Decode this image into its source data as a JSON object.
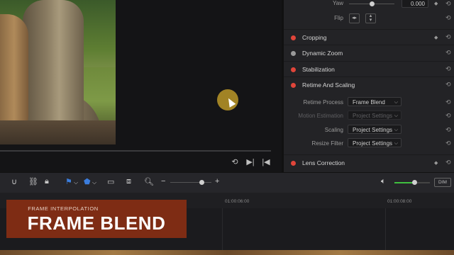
{
  "inspector": {
    "transform": {
      "yaw_label": "Yaw",
      "yaw_value": "0.000",
      "yaw_slider_level": 0.5,
      "flip_label": "Flip"
    },
    "sections": [
      {
        "label": "Cropping",
        "enabled": true
      },
      {
        "label": "Dynamic Zoom",
        "enabled": false
      },
      {
        "label": "Stabilization",
        "enabled": true
      },
      {
        "label": "Retime And Scaling",
        "enabled": true
      },
      {
        "label": "Lens Correction",
        "enabled": true
      }
    ],
    "retime": {
      "process_label": "Retime Process",
      "process_value": "Frame Blend",
      "motion_label": "Motion Estimation",
      "motion_value": "Project Settings",
      "scaling_label": "Scaling",
      "scaling_value": "Project Settings",
      "resize_label": "Resize Filter",
      "resize_value": "Project Settings"
    }
  },
  "toolbar": {
    "audio_level": 0.55,
    "dim_label": "DIM"
  },
  "timeline": {
    "timecodes": [
      "01:00:06:00",
      "01:00:08:00"
    ]
  },
  "title_card": {
    "subtitle": "FRAME INTERPOLATION",
    "title": "FRAME BLEND"
  },
  "colors": {
    "accent": "#e0453a",
    "marker_blue": "#3b7ddd",
    "title_card": "#7e2c14",
    "cursor_highlight": "#ba9628"
  }
}
